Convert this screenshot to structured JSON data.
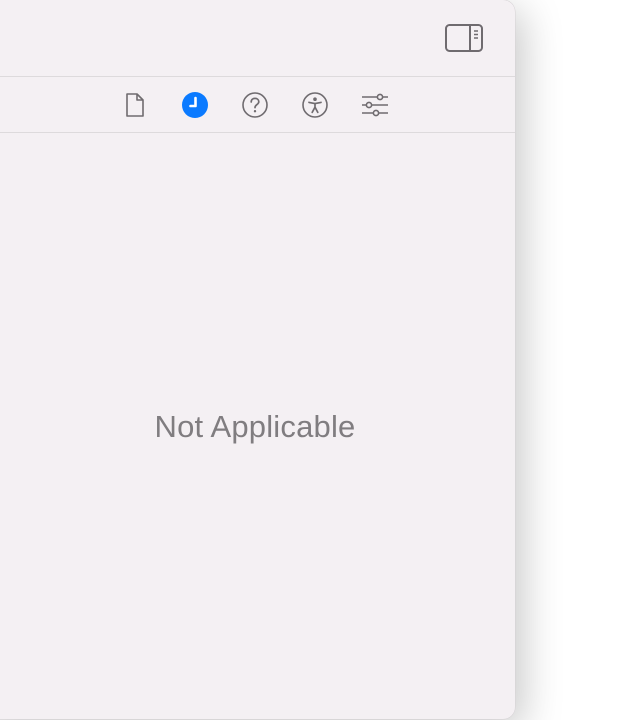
{
  "colors": {
    "panel_background": "#f4f0f3",
    "divider": "#dddadc",
    "icon": "#6f6b6f",
    "accent": "#0a7aff",
    "placeholder_text": "#807d80"
  },
  "toolbar": {
    "toggle_icon": "sidebar-right-icon"
  },
  "inspector_tabs": [
    {
      "icon": "document-icon",
      "selected": false
    },
    {
      "icon": "clock-icon",
      "selected": true
    },
    {
      "icon": "question-icon",
      "selected": false
    },
    {
      "icon": "accessibility-icon",
      "selected": false
    },
    {
      "icon": "sliders-icon",
      "selected": false
    }
  ],
  "content": {
    "message": "Not Applicable"
  }
}
